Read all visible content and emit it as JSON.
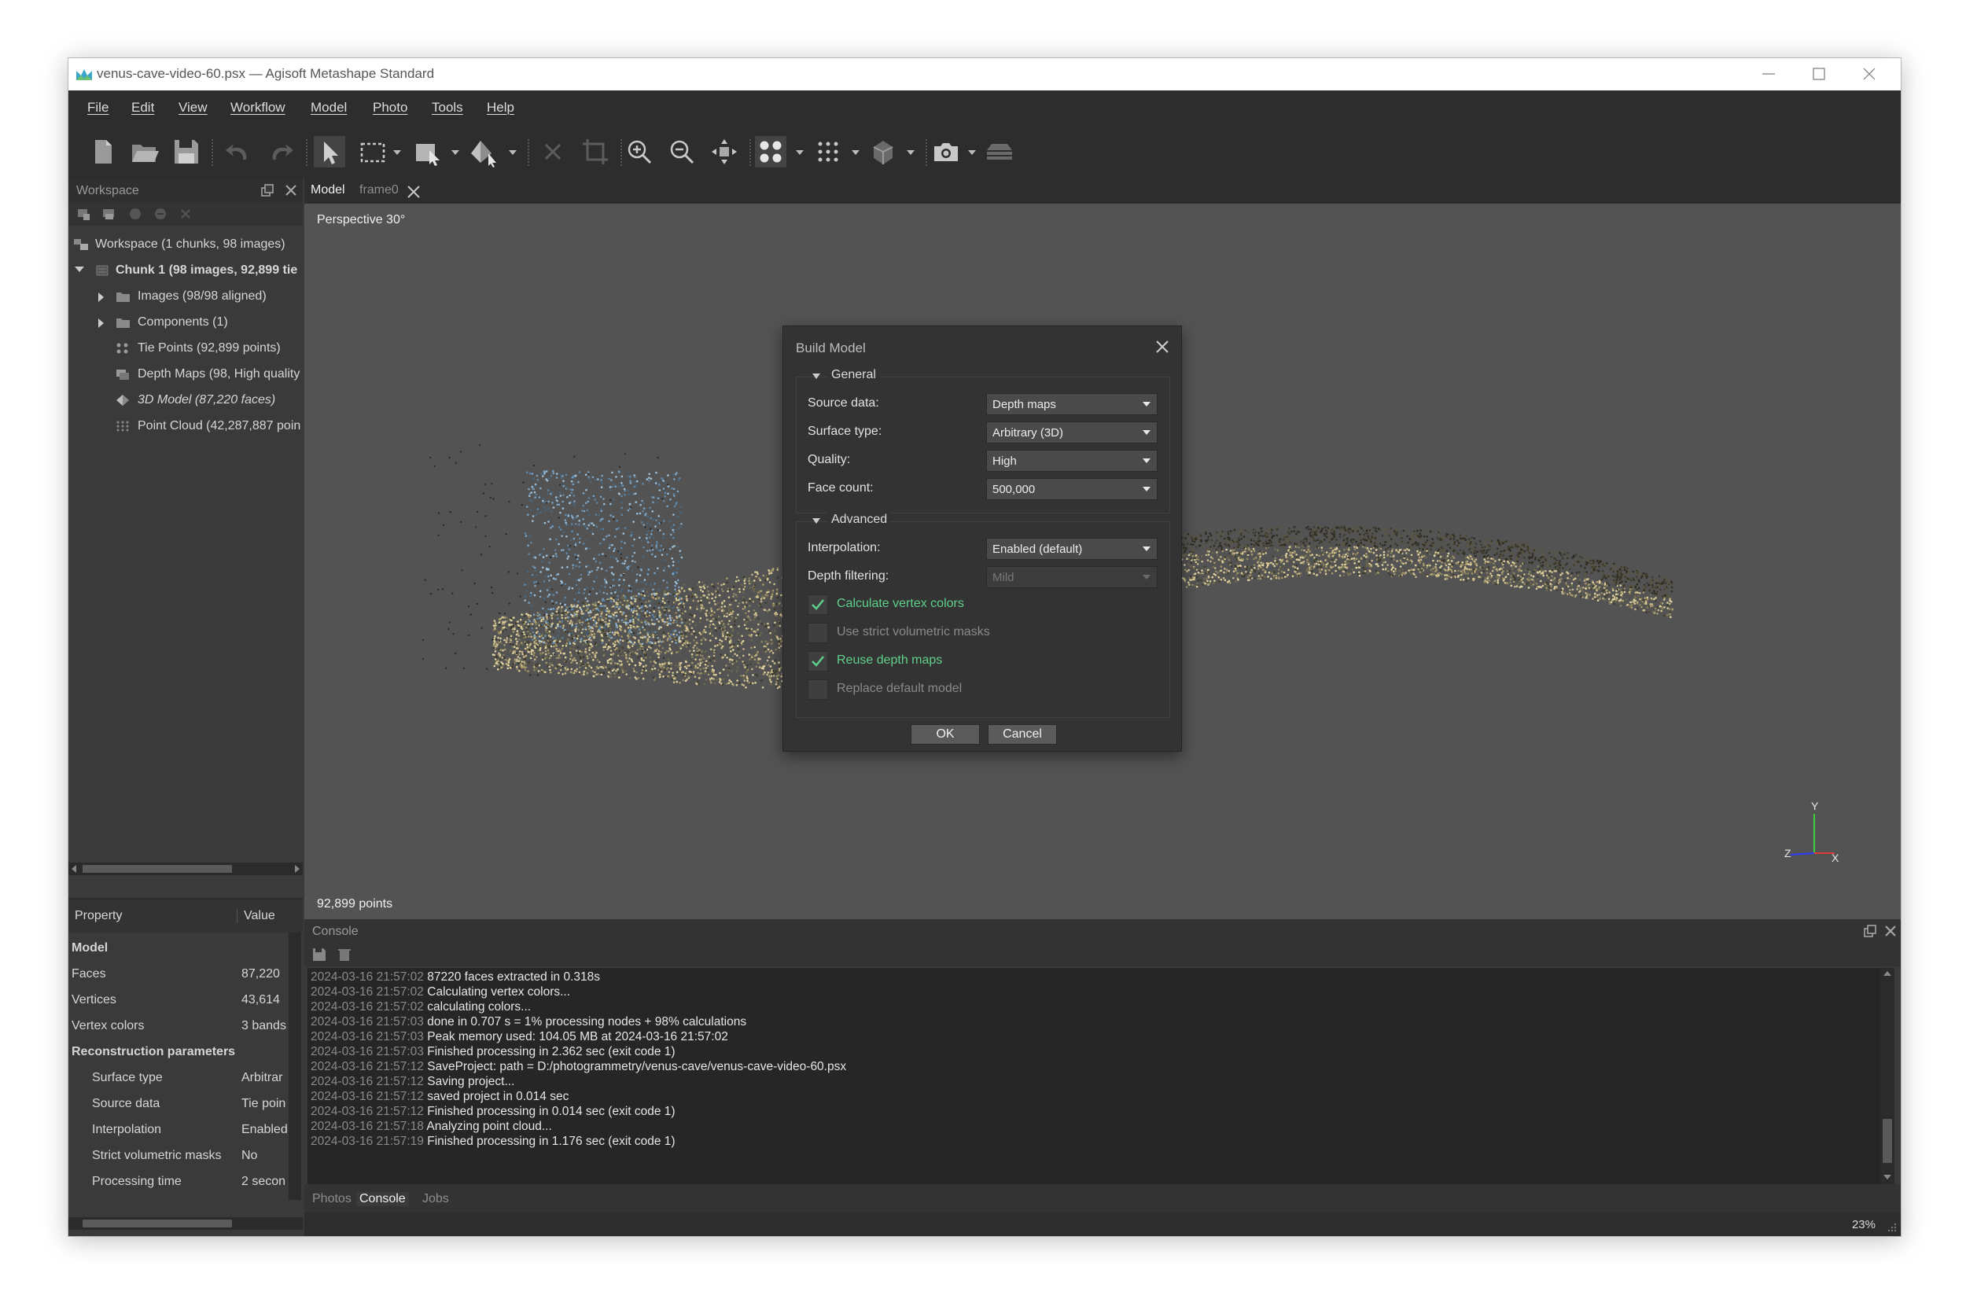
{
  "window": {
    "title": "venus-cave-video-60.psx — Agisoft Metashape Standard"
  },
  "menu": [
    "File",
    "Edit",
    "View",
    "Workflow",
    "Model",
    "Photo",
    "Tools",
    "Help"
  ],
  "toolbar_icons": [
    "new-icon",
    "open-icon",
    "save-icon",
    "undo-icon",
    "redo-icon",
    "select-icon",
    "rect-select-icon",
    "shape-icon",
    "move-object-icon",
    "delete-icon",
    "crop-icon",
    "zoom-in-icon",
    "zoom-out-icon",
    "reset-view-icon",
    "show-points-icon",
    "show-dense-icon",
    "model-view-icon",
    "camera-icon",
    "layers-icon"
  ],
  "workspace": {
    "panel_title": "Workspace",
    "root": "Workspace (1 chunks, 98 images)",
    "chunk": "Chunk 1 (98 images, 92,899 tie",
    "items": [
      {
        "label": "Images (98/98 aligned)",
        "icon": "folder-icon"
      },
      {
        "label": "Components (1)",
        "icon": "folder-icon"
      },
      {
        "label": "Tie Points (92,899 points)",
        "icon": "tie-points-icon"
      },
      {
        "label": "Depth Maps (98, High quality",
        "icon": "depth-maps-icon"
      },
      {
        "label": "3D Model (87,220 faces)",
        "icon": "model-icon"
      },
      {
        "label": "Point Cloud (42,287,887 poin",
        "icon": "point-cloud-icon"
      }
    ]
  },
  "properties": {
    "col_property": "Property",
    "col_value": "Value",
    "rows": [
      {
        "k": "Model",
        "v": "",
        "group": true
      },
      {
        "k": "Faces",
        "v": "87,220"
      },
      {
        "k": "Vertices",
        "v": "43,614"
      },
      {
        "k": "Vertex colors",
        "v": "3 bands"
      },
      {
        "k": "Reconstruction parameters",
        "v": "",
        "group": true
      },
      {
        "k": "Surface type",
        "v": "Arbitrar"
      },
      {
        "k": "Source data",
        "v": "Tie poin"
      },
      {
        "k": "Interpolation",
        "v": "Enabled"
      },
      {
        "k": "Strict volumetric masks",
        "v": "No"
      },
      {
        "k": "Processing time",
        "v": "2 secon"
      }
    ]
  },
  "view_tabs": [
    "Model",
    "frame0"
  ],
  "viewport": {
    "projection": "Perspective 30°",
    "point_count": "92,899 points",
    "axis": {
      "x": "X",
      "y": "Y",
      "z": "Z"
    }
  },
  "dialog": {
    "title": "Build Model",
    "general_title": "General",
    "general": [
      {
        "label": "Source data:",
        "value": "Depth maps"
      },
      {
        "label": "Surface type:",
        "value": "Arbitrary (3D)"
      },
      {
        "label": "Quality:",
        "value": "High"
      },
      {
        "label": "Face count:",
        "value": "500,000"
      }
    ],
    "advanced_title": "Advanced",
    "advanced": [
      {
        "label": "Interpolation:",
        "value": "Enabled (default)",
        "disabled": false
      },
      {
        "label": "Depth filtering:",
        "value": "Mild",
        "disabled": true
      }
    ],
    "checks": [
      {
        "label": "Calculate vertex colors",
        "checked": true
      },
      {
        "label": "Use strict volumetric masks",
        "checked": false
      },
      {
        "label": "Reuse depth maps",
        "checked": true
      },
      {
        "label": "Replace default model",
        "checked": false
      }
    ],
    "ok": "OK",
    "cancel": "Cancel"
  },
  "console": {
    "title": "Console",
    "lines": [
      {
        "ts": "2024-03-16 21:57:02",
        "msg": "87220 faces extracted in 0.318s"
      },
      {
        "ts": "2024-03-16 21:57:02",
        "msg": "Calculating vertex colors..."
      },
      {
        "ts": "2024-03-16 21:57:02",
        "msg": "calculating colors..."
      },
      {
        "ts": "2024-03-16 21:57:03",
        "msg": "done in 0.707 s = 1% processing nodes + 98% calculations"
      },
      {
        "ts": "2024-03-16 21:57:03",
        "msg": "Peak memory used: 104.05 MB at 2024-03-16 21:57:02"
      },
      {
        "ts": "2024-03-16 21:57:03",
        "msg": "Finished processing in 2.362 sec (exit code 1)"
      },
      {
        "ts": "2024-03-16 21:57:12",
        "msg": "SaveProject: path = D:/photogrammetry/venus-cave/venus-cave-video-60.psx"
      },
      {
        "ts": "2024-03-16 21:57:12",
        "msg": "Saving project..."
      },
      {
        "ts": "2024-03-16 21:57:12",
        "msg": "saved project in 0.014 sec"
      },
      {
        "ts": "2024-03-16 21:57:12",
        "msg": "Finished processing in 0.014 sec (exit code 1)"
      },
      {
        "ts": "2024-03-16 21:57:18",
        "msg": "Analyzing point cloud..."
      },
      {
        "ts": "2024-03-16 21:57:19",
        "msg": "Finished processing in 1.176 sec (exit code 1)"
      }
    ]
  },
  "bottom_tabs": [
    "Photos",
    "Console",
    "Jobs"
  ],
  "active_bottom_tab": "Console",
  "status": {
    "zoom": "23%"
  },
  "colors": {
    "accent_green": "#5fd08a",
    "bg_dark": "#2d2d2d",
    "viewport": "#535353"
  }
}
